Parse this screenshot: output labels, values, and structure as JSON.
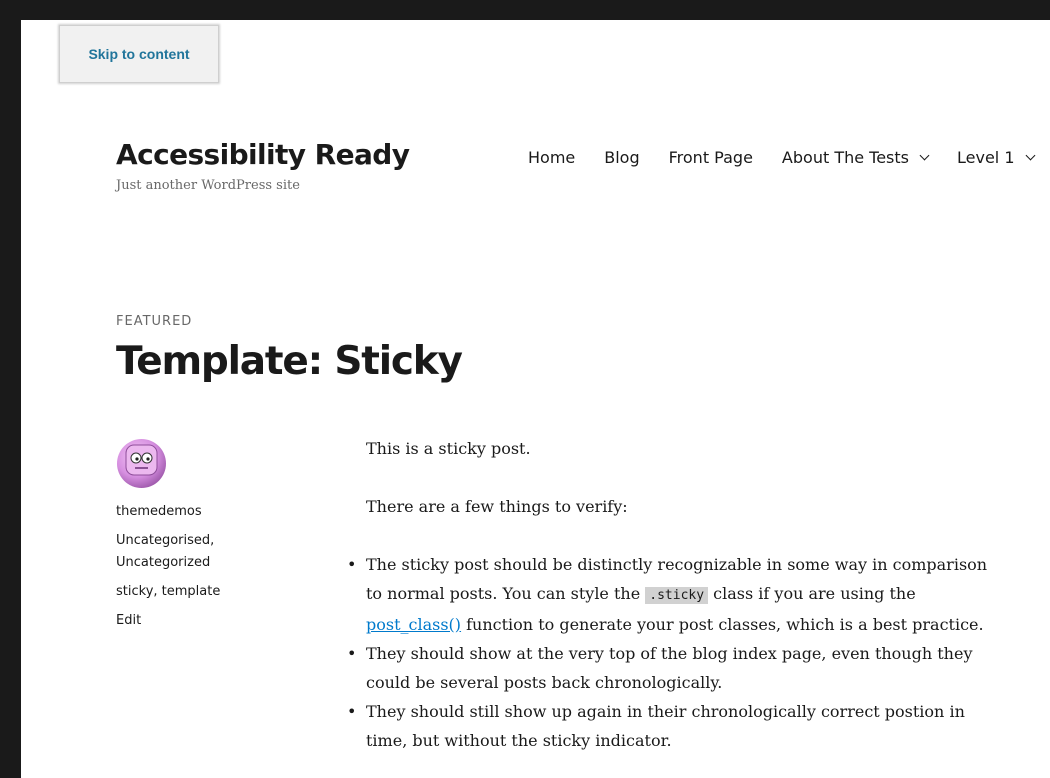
{
  "skip_link": "Skip to content",
  "site": {
    "title": "Accessibility Ready",
    "description": "Just another WordPress site"
  },
  "nav": {
    "items": [
      {
        "label": "Home"
      },
      {
        "label": "Blog"
      },
      {
        "label": "Front Page"
      },
      {
        "label": "About The Tests"
      },
      {
        "label": "Level 1"
      }
    ]
  },
  "post": {
    "kicker": "FEATURED",
    "title": "Template: Sticky",
    "meta": {
      "author": "themedemos",
      "categories": [
        "Uncategorised,",
        "Uncategorized"
      ],
      "tags": "sticky, template",
      "edit": "Edit"
    },
    "paragraphs": [
      "This is a sticky post.",
      "There are a few things to verify:"
    ],
    "bullets": {
      "b1_before": "The sticky post should be distinctly recognizable in some way in comparison to normal posts. You can style the ",
      "b1_code": ".sticky",
      "b1_middle": " class if you are using the ",
      "b1_link": "post_class()",
      "b1_after": " function to generate your post classes, which is a best practice.",
      "b2": "They should show at the very top of the blog index page, even though they could be several posts back chronologically.",
      "b3": "They should still show up again in their chronologically correct postion in time, but without the sticky indicator."
    }
  },
  "colors": {
    "link": "#007acc",
    "skip_link": "#21759b",
    "text": "#1a1a1a",
    "muted": "#686868"
  }
}
